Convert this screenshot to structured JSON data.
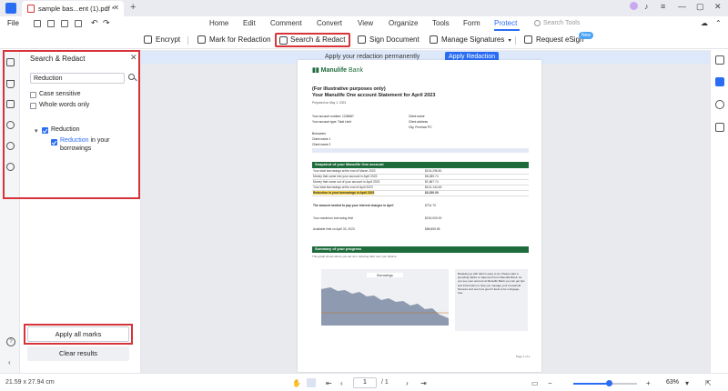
{
  "window": {
    "tab_title": "sample bas...ent (1).pdf *",
    "minimize": "—",
    "maximize": "▢",
    "close": "✕"
  },
  "menu": {
    "file": "File",
    "tabs": [
      "Home",
      "Edit",
      "Comment",
      "Convert",
      "View",
      "Organize",
      "Tools",
      "Form",
      "Protect"
    ],
    "active_tab": "Protect",
    "search_tools_placeholder": "Search Tools"
  },
  "toolbar": {
    "encrypt": "Encrypt",
    "mark_for_redaction": "Mark for Redaction",
    "search_redact": "Search & Redact",
    "sign_document": "Sign Document",
    "manage_signatures": "Manage Signatures",
    "request_esign": "Request eSign",
    "new_badge": "New"
  },
  "panel": {
    "title": "Search & Redact",
    "search_value": "Reduction",
    "case_sensitive": "Case sensitive",
    "whole_words": "Whole words only",
    "tree_root": "Reduction",
    "result_hit": "Reduction",
    "result_rest": " in your borrowings",
    "apply_all": "Apply all marks",
    "clear_results": "Clear results"
  },
  "redact_bar": {
    "message": "Apply your redaction permanently",
    "button": "Apply Redaction"
  },
  "document": {
    "logo": "Manulife",
    "logo_suffix": " Bank",
    "heading1": "(For illustrative purposes only)",
    "heading2": "Your Manulife One account Statement for April 2023",
    "prepared": "Prepared on May 1, 2023",
    "acct_number": "Your account number: 1234567",
    "acct_type": "Your account type: Total Limit",
    "client_name": "Client name",
    "client_addr1": "Client address",
    "client_addr2": "City, Province PC",
    "borrowers": "Borrowers",
    "client_name1": "Client name 1",
    "client_name2": "Client name 2",
    "snapshot_title": "Snapshot of your Manulife One account",
    "snapshot_rows": [
      {
        "label": "Your total borrowings at the end of March 2023",
        "value": "$104,296.50"
      },
      {
        "label": "Money that came into your account in April 2023",
        "value": "$5,089.74"
      },
      {
        "label": "Money that came out of your account in April 2023",
        "value": "$1,867.74"
      },
      {
        "label": "Your total borrowings at the end of April 2023",
        "value": "$101,144.45"
      },
      {
        "label": "Reduction in your borrowings in April 2023",
        "value": "$3,150.00"
      }
    ],
    "interest_row": {
      "label": "The amount needed to pay your interest charges in April",
      "value": "$731.70"
    },
    "limit_row": {
      "label": "Your maximum borrowing limit",
      "value": "$190,000.00"
    },
    "available_row": {
      "label": "Available limit on April 30, 2023",
      "value": "$88,855.55"
    },
    "progress_title": "Summary of your progress",
    "progress_sub": "This graph shows where you are at in reducing debt over your lifetime.",
    "chart_label": "Borrowings",
    "side_note": "Breaking up with debt is easy to do. Please start a spending habits or statement from Manulife Bank. As you see your account at Manulife Bank you can get tips and information to help you manage your household finances and see how good it feels to be mortgage-free.",
    "page_no": "Page 1 of 2"
  },
  "status": {
    "page_size": "21.59 x 27.94 cm",
    "page_current": "1",
    "page_total": "/ 1",
    "zoom_value": "63%",
    "zoom_fraction": 0.56
  },
  "colors": {
    "accent": "#2a6df4",
    "highlight_frame": "#d6343a",
    "doc_green": "#1e6b3b"
  }
}
